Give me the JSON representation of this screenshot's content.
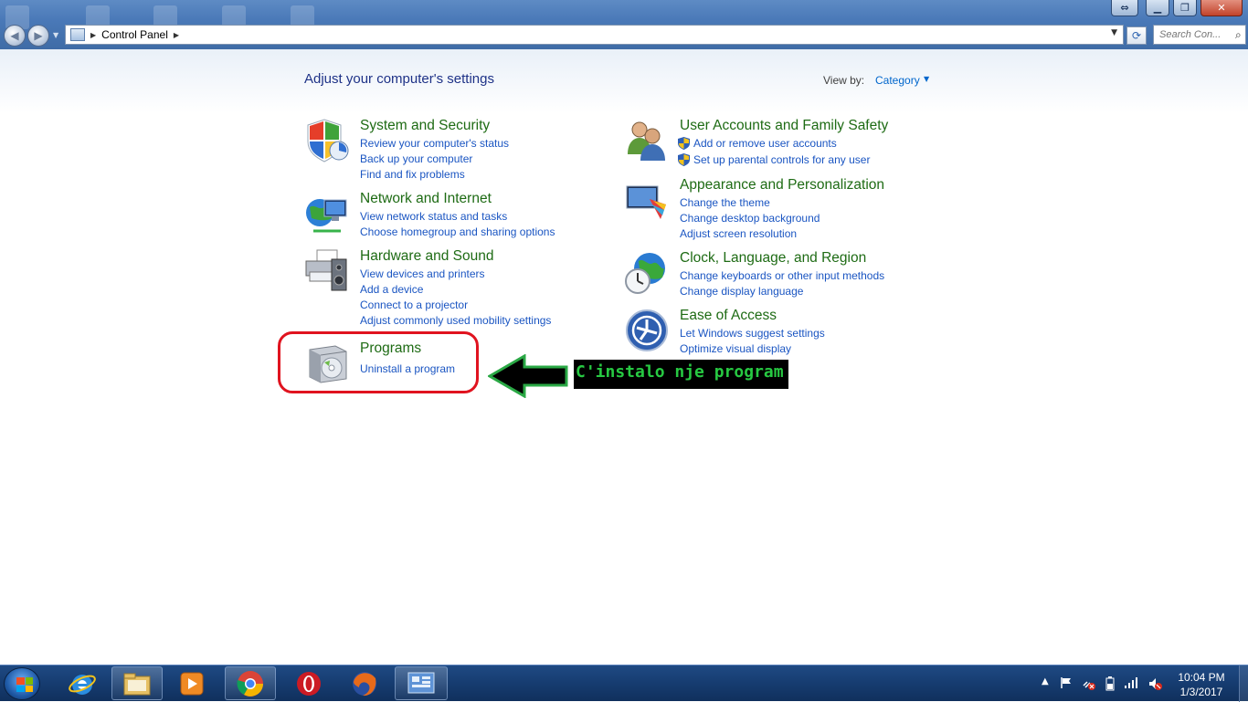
{
  "window": {
    "address": {
      "breadcrumb": "Control Panel"
    },
    "search": {
      "placeholder": "Search Con..."
    }
  },
  "page": {
    "heading": "Adjust your computer's settings",
    "view_by_label": "View by:",
    "view_by_value": "Category"
  },
  "categories_left": [
    {
      "title": "System and Security",
      "icon": "shield-icon",
      "links": [
        "Review your computer's status",
        "Back up your computer",
        "Find and fix problems"
      ]
    },
    {
      "title": "Network and Internet",
      "icon": "network-globe-icon",
      "links": [
        "View network status and tasks",
        "Choose homegroup and sharing options"
      ]
    },
    {
      "title": "Hardware and Sound",
      "icon": "printer-speaker-icon",
      "links": [
        "View devices and printers",
        "Add a device",
        "Connect to a projector",
        "Adjust commonly used mobility settings"
      ]
    },
    {
      "title": "Programs",
      "icon": "programs-box-icon",
      "links": [
        "Uninstall a program"
      ]
    }
  ],
  "categories_right": [
    {
      "title": "User Accounts and Family Safety",
      "icon": "users-icon",
      "links": [
        "Add or remove user accounts",
        "Set up parental controls for any user"
      ]
    },
    {
      "title": "Appearance and Personalization",
      "icon": "display-paint-icon",
      "links": [
        "Change the theme",
        "Change desktop background",
        "Adjust screen resolution"
      ]
    },
    {
      "title": "Clock, Language, and Region",
      "icon": "clock-globe-icon",
      "links": [
        "Change keyboards or other input methods",
        "Change display language"
      ]
    },
    {
      "title": "Ease of Access",
      "icon": "ease-of-access-icon",
      "links": [
        "Let Windows suggest settings",
        "Optimize visual display"
      ]
    }
  ],
  "annotation": {
    "text": "C'instalo nje program",
    "highlight_color": "#e0131f",
    "arrow_color": "#2aa845",
    "text_color": "#27c942"
  },
  "taskbar": {
    "pinned": [
      "internet-explorer-icon",
      "file-explorer-icon",
      "media-player-icon",
      "chrome-icon",
      "opera-icon",
      "firefox-icon",
      "control-panel-icon"
    ],
    "time": "10:04 PM",
    "date": "1/3/2017"
  },
  "colors": {
    "category_title": "#1e6b14",
    "link": "#1a55c2",
    "heading": "#1e3287"
  }
}
